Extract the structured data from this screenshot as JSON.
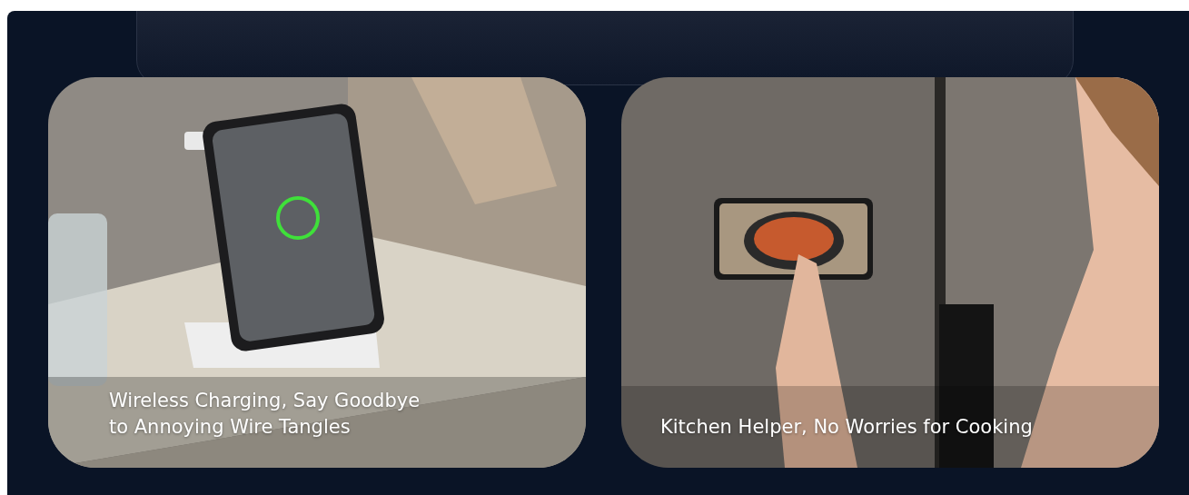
{
  "cards": [
    {
      "caption": "Wireless Charging, Say Goodbye to Annoying Wire Tangles"
    },
    {
      "caption": "Kitchen Helper, No Worries for Cooking"
    }
  ]
}
